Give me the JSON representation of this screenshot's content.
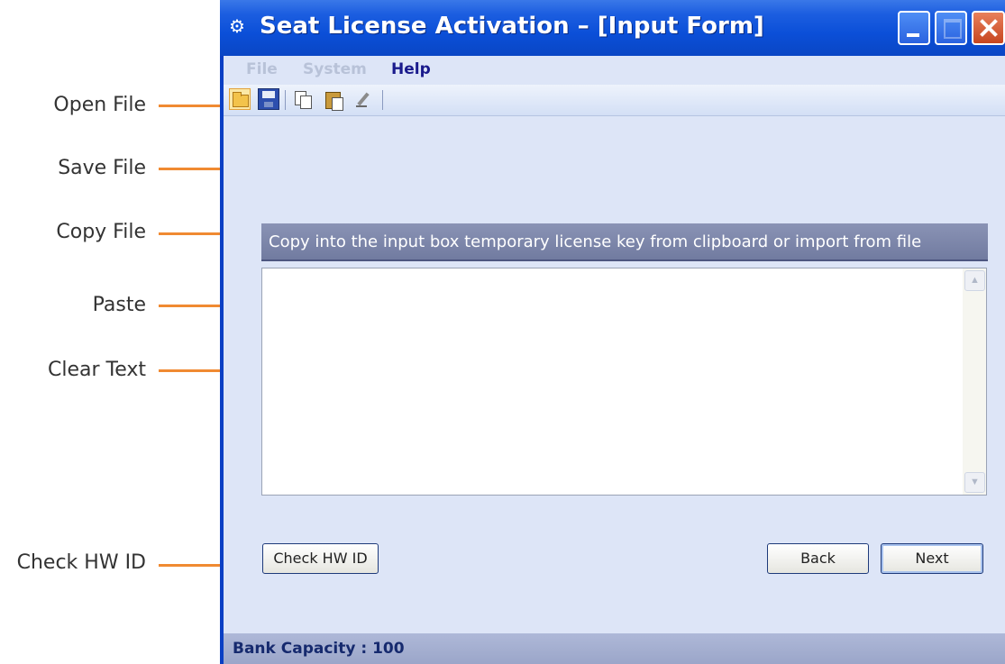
{
  "callouts": {
    "open_file": "Open File",
    "save_file": "Save File",
    "copy_file": "Copy File",
    "paste": "Paste",
    "clear_text": "Clear Text",
    "check_hw_id": "Check HW ID"
  },
  "window": {
    "title": "Seat License Activation  – [Input Form]",
    "app_icon": "app-icon"
  },
  "menu": {
    "items": [
      {
        "label": "File",
        "enabled": false
      },
      {
        "label": "System",
        "enabled": false
      },
      {
        "label": "Help",
        "enabled": true
      }
    ]
  },
  "toolbar": {
    "icons": [
      "open-folder-icon",
      "save-disk-icon",
      "copy-icon",
      "paste-icon",
      "clear-eraser-icon"
    ]
  },
  "panel": {
    "header": "Copy into the input box temporary license key from clipboard or import from file",
    "input_value": ""
  },
  "buttons": {
    "check_hw_id": "Check HW ID",
    "back": "Back",
    "next": "Next"
  },
  "status": {
    "text": "Bank Capacity :  100"
  },
  "colors": {
    "callout_line": "#f08a32",
    "titlebar": "#0b4fd8",
    "client_bg": "#dde5f7"
  }
}
